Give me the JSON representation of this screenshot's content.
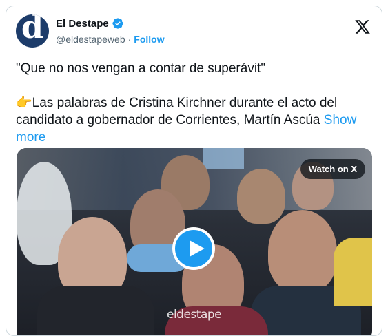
{
  "author": {
    "display_name": "El Destape",
    "handle": "@eldestapeweb",
    "avatar_letter": "d",
    "follow_label": "Follow"
  },
  "tweet": {
    "line1": "\"Que no nos vengan a contar de superávit\"",
    "line2_emoji": "👉",
    "line2": "Las palabras de Cristina Kirchner durante el acto del candidato a gobernador de Corrientes, Martín Ascúa",
    "show_more": "Show more"
  },
  "media": {
    "watch_label": "Watch on X",
    "watermark": "eldestape"
  },
  "colors": {
    "accent": "#1d9bf0",
    "text": "#0f1419",
    "secondary": "#536471",
    "border": "#cfd9de"
  }
}
